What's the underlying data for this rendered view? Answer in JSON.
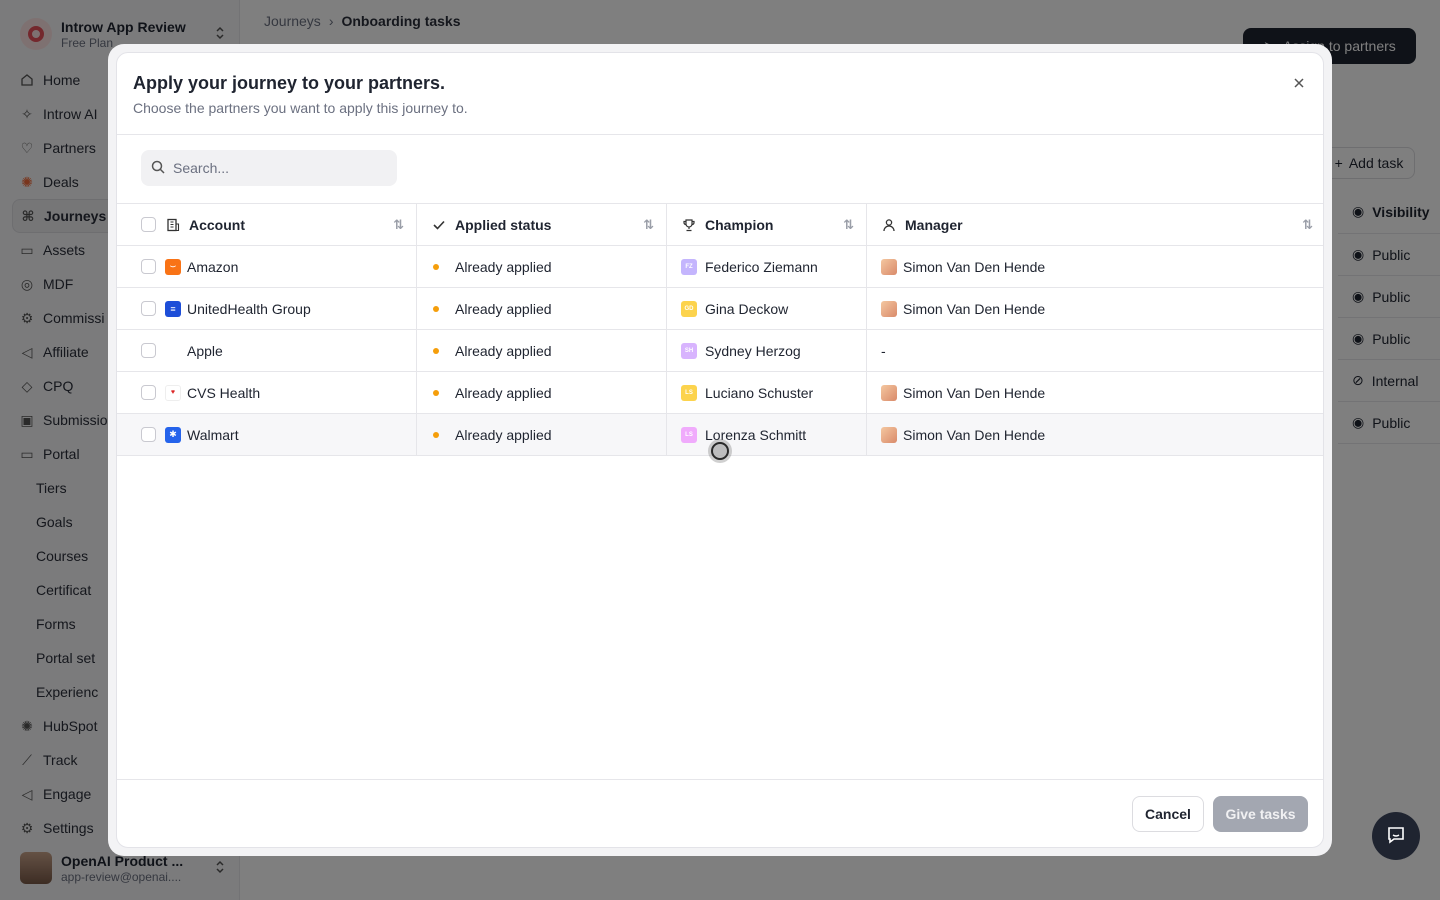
{
  "workspace": {
    "name": "Introw App Review",
    "plan": "Free Plan"
  },
  "sidebar": {
    "items": [
      {
        "label": "Home",
        "icon": "home-icon"
      },
      {
        "label": "Introw AI",
        "icon": "sparkle-icon"
      },
      {
        "label": "Partners",
        "icon": "handshake-icon"
      },
      {
        "label": "Deals",
        "icon": "hubspot-icon"
      },
      {
        "label": "Journeys",
        "icon": "journeys-icon",
        "active": true
      },
      {
        "label": "Assets",
        "icon": "folder-icon"
      },
      {
        "label": "MDF",
        "icon": "coins-icon"
      },
      {
        "label": "Commissi",
        "icon": "commission-icon"
      },
      {
        "label": "Affiliate",
        "icon": "megaphone-icon"
      },
      {
        "label": "CPQ",
        "icon": "tag-icon"
      },
      {
        "label": "Submissio",
        "icon": "inbox-icon"
      },
      {
        "label": "Portal",
        "icon": "monitor-icon"
      }
    ],
    "sub_items": [
      "Tiers",
      "Goals",
      "Courses",
      "Certificat",
      "Forms",
      "Portal set",
      "Experienc"
    ],
    "bottom_items": [
      {
        "label": "HubSpot",
        "icon": "hubspot-icon"
      },
      {
        "label": "Track",
        "icon": "chart-icon"
      },
      {
        "label": "Engage",
        "icon": "megaphone-icon"
      },
      {
        "label": "Settings",
        "icon": "gear-icon"
      }
    ],
    "user": {
      "name": "OpenAI Product ...",
      "email": "app-review@openai...."
    }
  },
  "main": {
    "breadcrumb": {
      "parent": "Journeys",
      "current": "Onboarding tasks"
    },
    "assign_button": "Assign to partners",
    "add_task": "Add task",
    "visibility_header": "Visibility",
    "visibility_rows": [
      "Public",
      "Public",
      "Public",
      "Internal",
      "Public"
    ]
  },
  "modal": {
    "title": "Apply your journey to your partners.",
    "subtitle": "Choose the partners you want to apply this journey to.",
    "search_placeholder": "Search...",
    "columns": {
      "account": "Account",
      "status": "Applied status",
      "champion": "Champion",
      "manager": "Manager"
    },
    "rows": [
      {
        "account": "Amazon",
        "logo_color": "#f97316",
        "status": "Already applied",
        "champion": "Federico Ziemann",
        "champion_initials": "FZ",
        "champion_color": "#c4b5fd",
        "manager": "Simon Van Den Hende"
      },
      {
        "account": "UnitedHealth Group",
        "logo_color": "#1d4ed8",
        "status": "Already applied",
        "champion": "Gina Deckow",
        "champion_initials": "GD",
        "champion_color": "#fcd34d",
        "manager": "Simon Van Den Hende"
      },
      {
        "account": "Apple",
        "logo_color": "#111111",
        "status": "Already applied",
        "champion": "Sydney Herzog",
        "champion_initials": "SH",
        "champion_color": "#d8b4fe",
        "manager": "-"
      },
      {
        "account": "CVS Health",
        "logo_color": "#dc2626",
        "status": "Already applied",
        "champion": "Luciano Schuster",
        "champion_initials": "LS",
        "champion_color": "#fcd34d",
        "manager": "Simon Van Den Hende"
      },
      {
        "account": "Walmart",
        "logo_color": "#2563eb",
        "status": "Already applied",
        "champion": "Lorenza Schmitt",
        "champion_initials": "LS",
        "champion_color": "#f0abfc",
        "manager": "Simon Van Den Hende"
      }
    ],
    "cancel_label": "Cancel",
    "submit_label": "Give tasks"
  }
}
